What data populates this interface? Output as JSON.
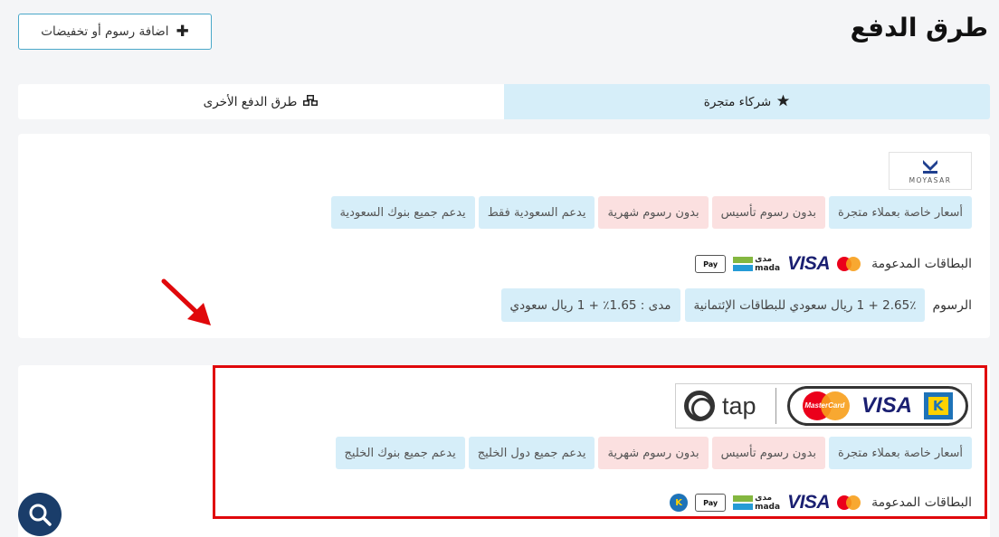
{
  "page": {
    "title": "طرق الدفع",
    "add_button_label": "اضافة رسوم أو تخفيضات"
  },
  "tabs": [
    {
      "label": "شركاء متجرة",
      "icon": "star-icon",
      "active": true
    },
    {
      "label": "طرق الدفع الأخرى",
      "icon": "cubes-icon",
      "active": false
    }
  ],
  "moyasar": {
    "logo_text": "MOYASAR",
    "badges": [
      {
        "label": "أسعار خاصة بعملاء متجرة",
        "color": "blue"
      },
      {
        "label": "بدون رسوم تأسيس",
        "color": "red"
      },
      {
        "label": "بدون رسوم شهرية",
        "color": "red"
      },
      {
        "label": "يدعم السعودية فقط",
        "color": "blue"
      },
      {
        "label": "يدعم جميع بنوك السعودية",
        "color": "blue"
      }
    ],
    "cards_label": "البطاقات المدعومة",
    "fees_label": "الرسوم",
    "fees": [
      "2.65٪ + 1 ريال سعودي للبطاقات الإئتمانية",
      "مدى : 1.65٪ + 1 ريال سعودي"
    ]
  },
  "tap": {
    "logo_text": "tap",
    "mastercard_text": "MasterCard",
    "badges": [
      {
        "label": "أسعار خاصة بعملاء متجرة",
        "color": "blue"
      },
      {
        "label": "بدون رسوم تأسيس",
        "color": "red"
      },
      {
        "label": "بدون رسوم شهرية",
        "color": "red"
      },
      {
        "label": "يدعم جميع دول الخليج",
        "color": "blue"
      },
      {
        "label": "يدعم جميع بنوك الخليج",
        "color": "blue"
      }
    ],
    "cards_label": "البطاقات المدعومة"
  },
  "card_brands": {
    "visa": "VISA",
    "mada_ar": "مدى",
    "mada_en": "mada",
    "apple_pay": "Pay",
    "knet": "K"
  },
  "colors": {
    "badge_blue": "#d6eef9",
    "badge_red": "#fbe0e0",
    "accent_border": "#4aa8c9",
    "highlight_red": "#e0080b",
    "fab_navy": "#1a3d6a"
  }
}
